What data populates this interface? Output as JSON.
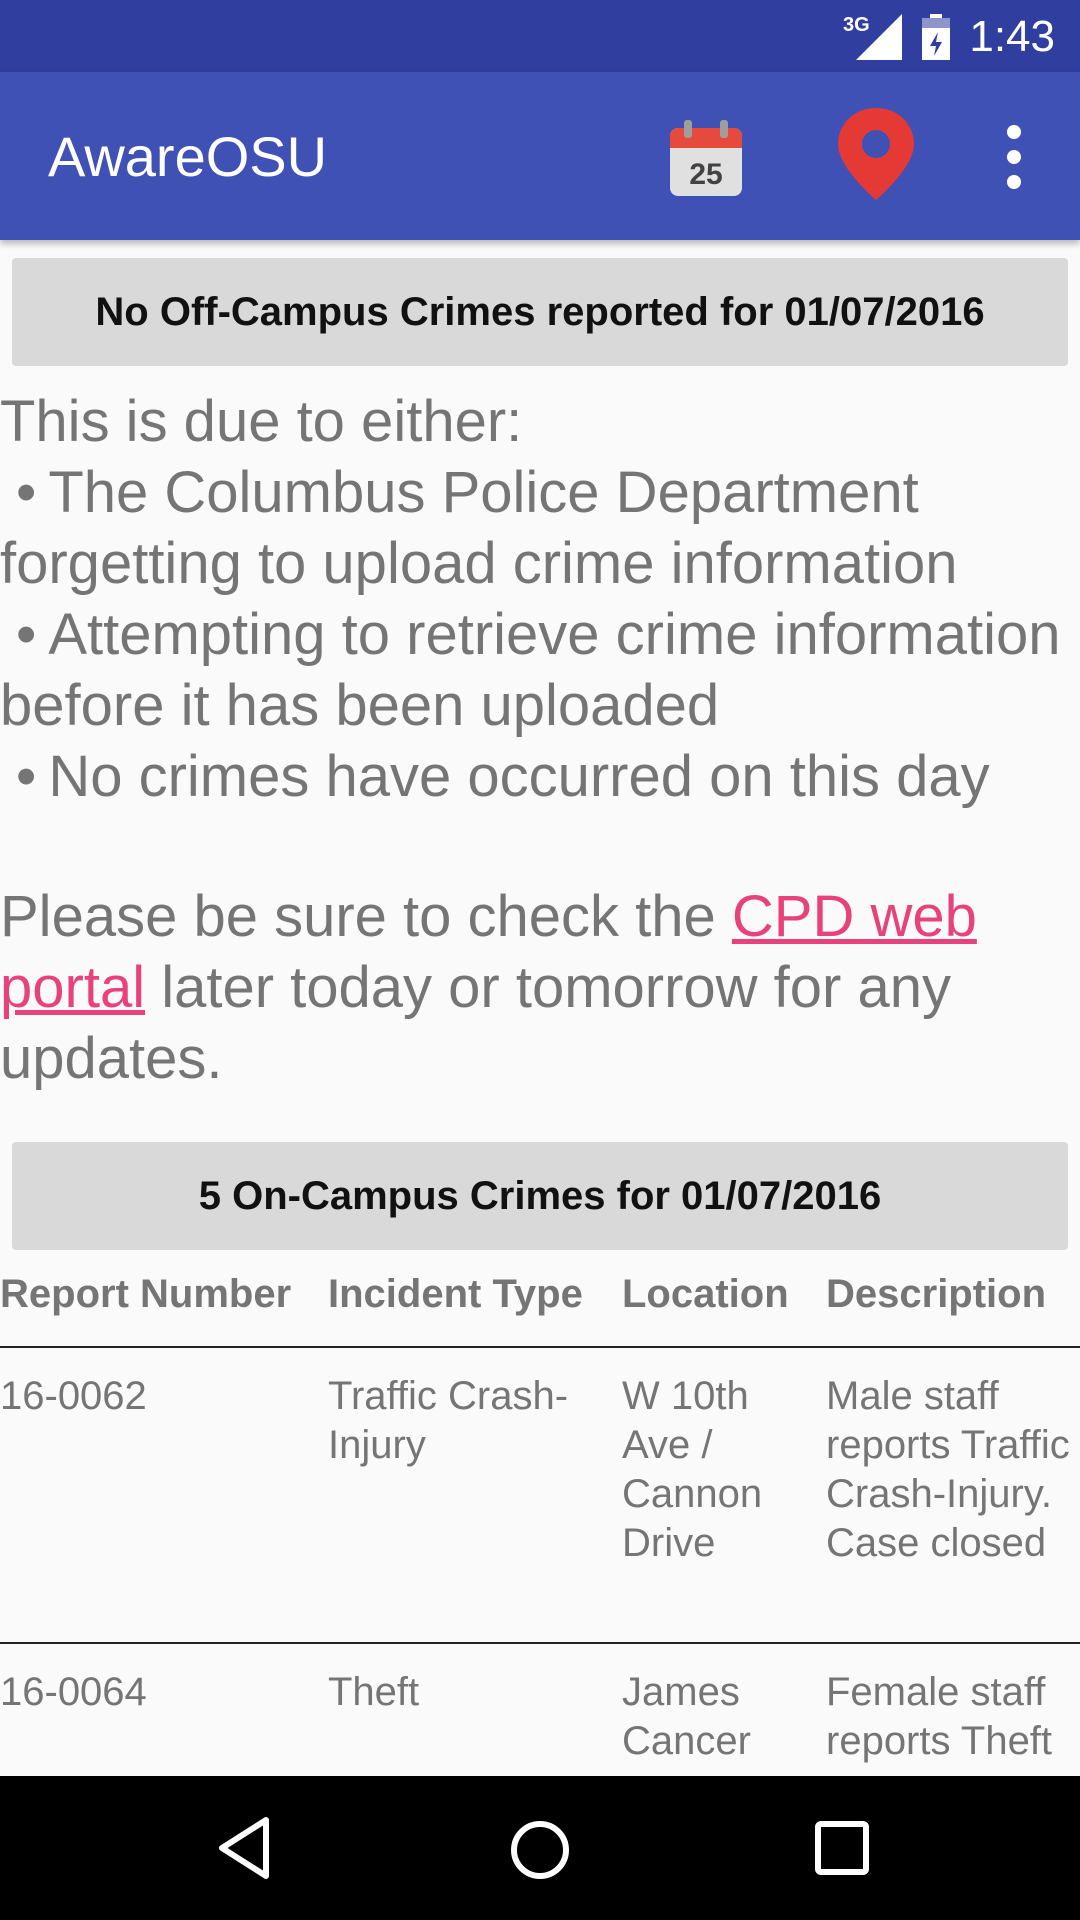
{
  "status_bar": {
    "time": "1:43",
    "network": "3G"
  },
  "app_bar": {
    "title": "AwareOSU",
    "calendar_day": "25",
    "actions": [
      "calendar-icon",
      "location-pin-icon",
      "more-vert-icon"
    ]
  },
  "off_campus": {
    "header": "No Off-Campus Crimes reported for 01/07/2016",
    "intro": "This is due to either:",
    "reasons": [
      "The Columbus Police Department forgetting to upload crime information",
      "Attempting to retrieve crime information before it has been uploaded",
      "No crimes have occurred on this day"
    ],
    "bullet": "•",
    "note_before": "Please be sure to check the ",
    "note_link": "CPD web portal",
    "note_after": " later today or tomorrow for any updates."
  },
  "on_campus": {
    "header": "5 On-Campus Crimes for 01/07/2016",
    "columns": [
      "Report Number",
      "Incident Type",
      "Location",
      "Description"
    ],
    "rows": [
      [
        "16-0062",
        "Traffic Crash-Injury",
        "W 10th Ave / Cannon Drive",
        "Male staff reports Traffic Crash-Injury. Case closed"
      ],
      [
        "16-0064",
        "Theft",
        "James Cancer",
        "Female staff reports Theft"
      ]
    ]
  },
  "colors": {
    "status_bar": "#303f9f",
    "app_bar": "#3f51b5",
    "link": "#e8427c",
    "header_box": "#d9d9d9",
    "body_text": "#757575"
  },
  "nav_bar": {
    "icons": [
      "back-icon",
      "home-icon",
      "recents-icon"
    ]
  }
}
